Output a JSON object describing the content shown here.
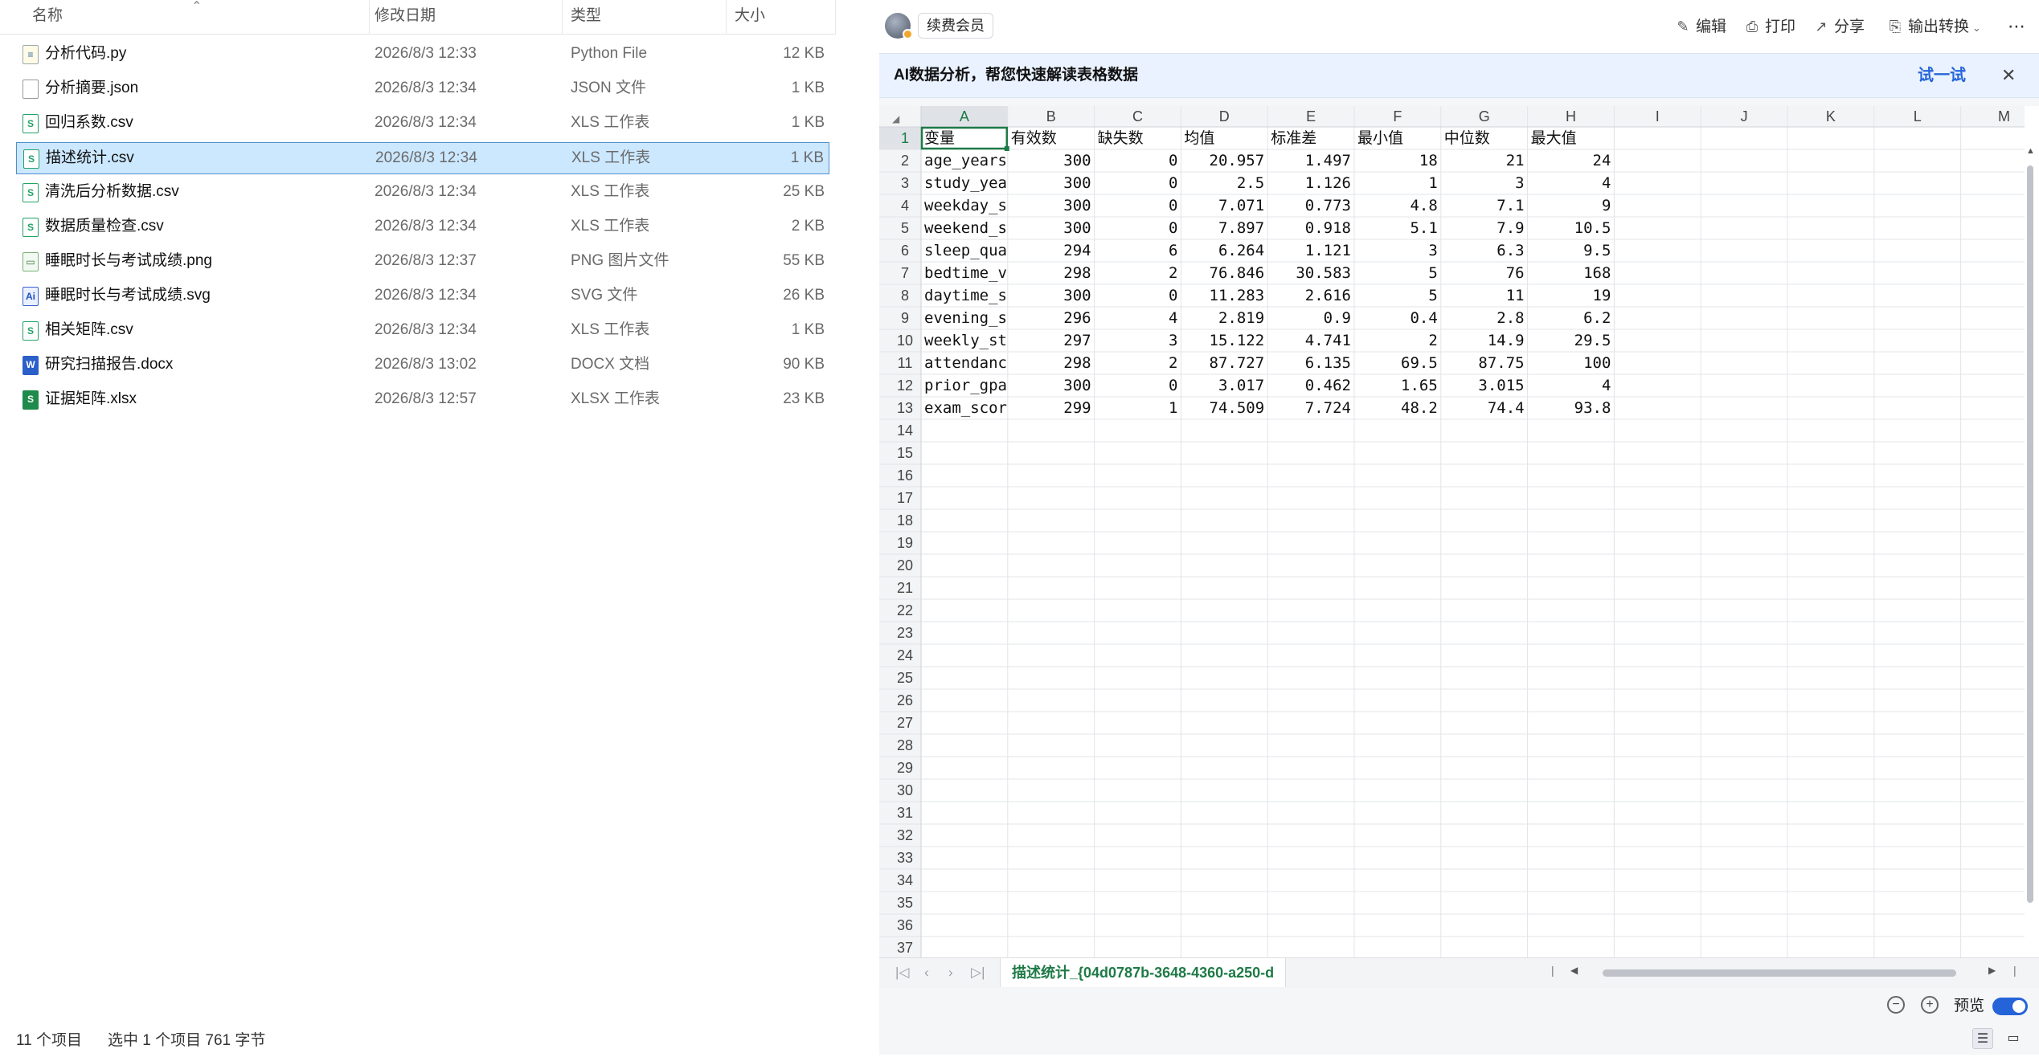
{
  "explorer": {
    "columns": {
      "name": "名称",
      "modified": "修改日期",
      "type": "类型",
      "size": "大小"
    },
    "files": [
      {
        "name": "分析代码.py",
        "date": "2026/8/3 12:33",
        "type": "Python File",
        "size": "12 KB",
        "icon": "python-file-icon",
        "glyph": "≡",
        "cls": "ic-py"
      },
      {
        "name": "分析摘要.json",
        "date": "2026/8/3 12:34",
        "type": "JSON 文件",
        "size": "1 KB",
        "icon": "json-file-icon",
        "glyph": "",
        "cls": "ic-json"
      },
      {
        "name": "回归系数.csv",
        "date": "2026/8/3 12:34",
        "type": "XLS 工作表",
        "size": "1 KB",
        "icon": "csv-file-icon",
        "glyph": "S",
        "cls": "ic-csv"
      },
      {
        "name": "描述统计.csv",
        "date": "2026/8/3 12:34",
        "type": "XLS 工作表",
        "size": "1 KB",
        "icon": "csv-file-icon",
        "glyph": "S",
        "cls": "ic-csv",
        "selected": true
      },
      {
        "name": "清洗后分析数据.csv",
        "date": "2026/8/3 12:34",
        "type": "XLS 工作表",
        "size": "25 KB",
        "icon": "csv-file-icon",
        "glyph": "S",
        "cls": "ic-csv"
      },
      {
        "name": "数据质量检查.csv",
        "date": "2026/8/3 12:34",
        "type": "XLS 工作表",
        "size": "2 KB",
        "icon": "csv-file-icon",
        "glyph": "S",
        "cls": "ic-csv"
      },
      {
        "name": "睡眠时长与考试成绩.png",
        "date": "2026/8/3 12:37",
        "type": "PNG 图片文件",
        "size": "55 KB",
        "icon": "png-file-icon",
        "glyph": "▭",
        "cls": "ic-png"
      },
      {
        "name": "睡眠时长与考试成绩.svg",
        "date": "2026/8/3 12:34",
        "type": "SVG 文件",
        "size": "26 KB",
        "icon": "svg-file-icon",
        "glyph": "Ai",
        "cls": "ic-svg"
      },
      {
        "name": "相关矩阵.csv",
        "date": "2026/8/3 12:34",
        "type": "XLS 工作表",
        "size": "1 KB",
        "icon": "csv-file-icon",
        "glyph": "S",
        "cls": "ic-csv"
      },
      {
        "name": "研究扫描报告.docx",
        "date": "2026/8/3 13:02",
        "type": "DOCX 文档",
        "size": "90 KB",
        "icon": "docx-file-icon",
        "glyph": "W",
        "cls": "ic-docx"
      },
      {
        "name": "证据矩阵.xlsx",
        "date": "2026/8/3 12:57",
        "type": "XLSX 工作表",
        "size": "23 KB",
        "icon": "xlsx-file-icon",
        "glyph": "S",
        "cls": "ic-xlsx"
      }
    ],
    "status": {
      "count": "11 个项目",
      "selection": "选中 1 个项目  761 字节"
    }
  },
  "viewer": {
    "renew_label": "续费会员",
    "toolbar": {
      "edit": "编辑",
      "print": "打印",
      "share": "分享",
      "export": "输出转换",
      "more": "⋯"
    },
    "ai_banner": {
      "text": "AI数据分析，帮您快速解读表格数据",
      "try": "试一试",
      "close": "✕"
    },
    "sheet_tab": "描述统计_{04d0787b-3648-4360-a250-d",
    "preview_label": "预览",
    "preview_on": true,
    "grid": {
      "columns": [
        "A",
        "B",
        "C",
        "D",
        "E",
        "F",
        "G",
        "H",
        "I",
        "J",
        "K",
        "L",
        "M"
      ],
      "row_count": 37,
      "active_cell": "A1",
      "cells": [
        [
          "变量",
          "有效数",
          "缺失数",
          "均值",
          "标准差",
          "最小值",
          "中位数",
          "最大值"
        ],
        [
          "age_years",
          "300",
          "0",
          "20.957",
          "1.497",
          "18",
          "21",
          "24"
        ],
        [
          "study_year",
          "300",
          "0",
          "2.5",
          "1.126",
          "1",
          "3",
          "4"
        ],
        [
          "weekday_sl",
          "300",
          "0",
          "7.071",
          "0.773",
          "4.8",
          "7.1",
          "9"
        ],
        [
          "weekend_sl",
          "300",
          "0",
          "7.897",
          "0.918",
          "5.1",
          "7.9",
          "10.5"
        ],
        [
          "sleep_qual",
          "294",
          "6",
          "6.264",
          "1.121",
          "3",
          "6.3",
          "9.5"
        ],
        [
          "bedtime_va",
          "298",
          "2",
          "76.846",
          "30.583",
          "5",
          "76",
          "168"
        ],
        [
          "daytime_sl",
          "300",
          "0",
          "11.283",
          "2.616",
          "5",
          "11",
          "19"
        ],
        [
          "evening_sc",
          "296",
          "4",
          "2.819",
          "0.9",
          "0.4",
          "2.8",
          "6.2"
        ],
        [
          "weekly_stu",
          "297",
          "3",
          "15.122",
          "4.741",
          "2",
          "14.9",
          "29.5"
        ],
        [
          "attendance",
          "298",
          "2",
          "87.727",
          "6.135",
          "69.5",
          "87.75",
          "100"
        ],
        [
          "prior_gpa",
          "300",
          "0",
          "3.017",
          "0.462",
          "1.65",
          "3.015",
          "4"
        ],
        [
          "exam_score",
          "299",
          "1",
          "74.509",
          "7.724",
          "48.2",
          "74.4",
          "93.8"
        ]
      ]
    }
  }
}
